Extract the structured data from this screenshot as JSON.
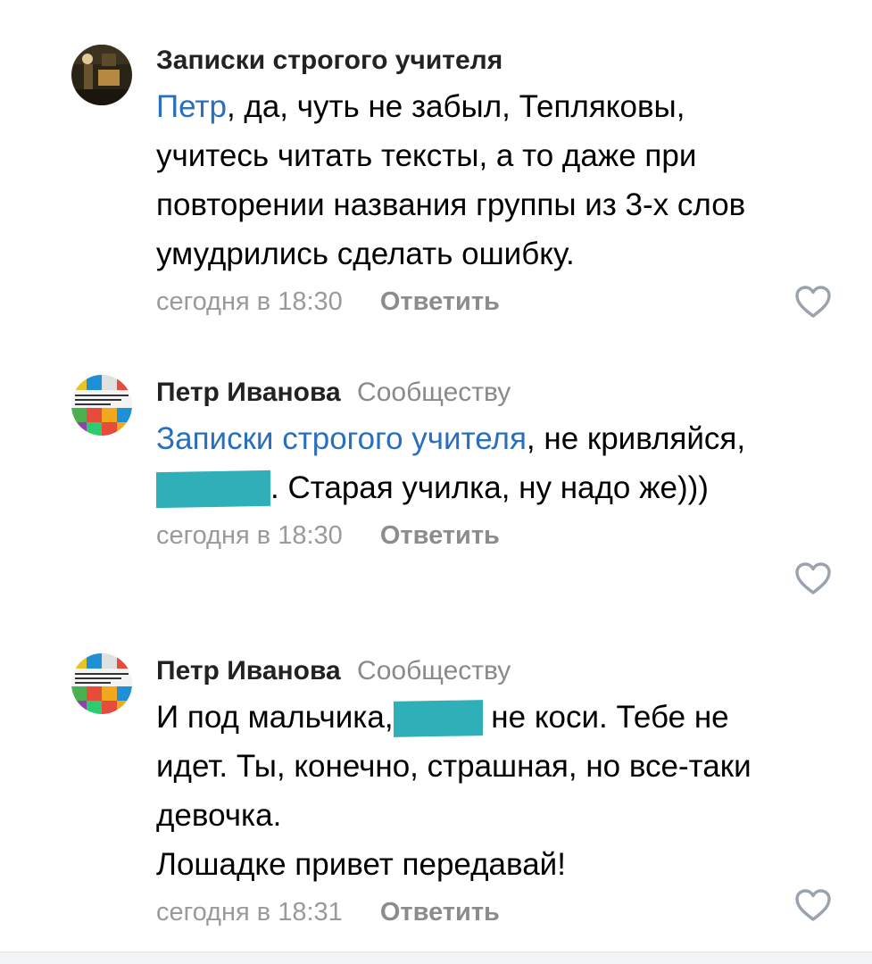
{
  "comments": [
    {
      "author": "Записки строгого учителя",
      "segments": [
        {
          "type": "mention",
          "text": "Петр"
        },
        {
          "type": "text",
          "text": ", да, чуть не забыл, Тепляковы, учитесь читать тексты, а то даже при повторении названия группы из 3-х слов умудрились сделать ошибку."
        }
      ],
      "time": "сегодня в 18:30",
      "reply_label": "Ответить",
      "like_icon": "heart-outline-icon"
    },
    {
      "author": "Петр Иванова",
      "target": "Сообществу",
      "segments": [
        {
          "type": "mention",
          "text": "Записки строгого учителя"
        },
        {
          "type": "text",
          "text": ", не кривляйся,"
        },
        {
          "type": "redacted"
        },
        {
          "type": "text",
          "text": ". Старая училка, ну надо же)))"
        }
      ],
      "time": "сегодня в 18:30",
      "reply_label": "Ответить",
      "like_icon": "heart-outline-icon"
    },
    {
      "author": "Петр Иванова",
      "target": "Сообществу",
      "segments": [
        {
          "type": "text",
          "text": "И под мальчика,"
        },
        {
          "type": "redacted"
        },
        {
          "type": "text",
          "text": " не коси. Тебе не идет. Ты, конечно, страшная, но все-таки девочка."
        },
        {
          "type": "break"
        },
        {
          "type": "text",
          "text": "Лошадке привет передавай!"
        }
      ],
      "time": "сегодня в 18:31",
      "reply_label": "Ответить",
      "like_icon": "heart-outline-icon"
    }
  ],
  "colors": {
    "mention": "#2a6fbd",
    "secondary_text": "#8a8a8a",
    "redaction": "#2fb0b8",
    "like_outline": "#99a2ad"
  }
}
